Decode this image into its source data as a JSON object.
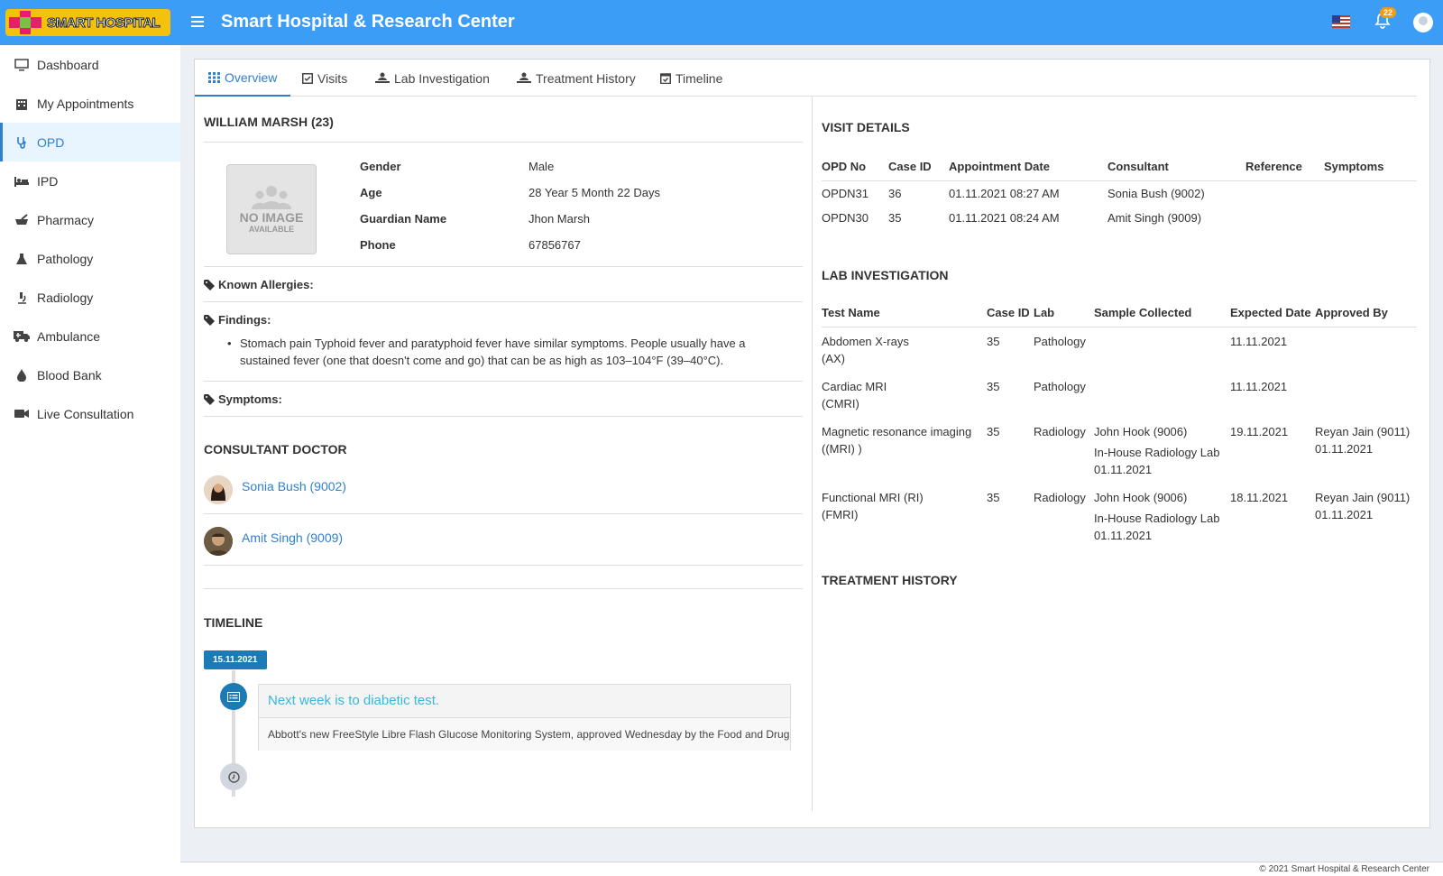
{
  "app": {
    "logo_text": "SMART HOSPITAL",
    "title": "Smart Hospital & Research Center",
    "notification_count": "22"
  },
  "sidebar": {
    "items": [
      {
        "label": "Dashboard",
        "icon": "monitor-icon"
      },
      {
        "label": "My Appointments",
        "icon": "building-icon"
      },
      {
        "label": "OPD",
        "icon": "stethoscope-icon"
      },
      {
        "label": "IPD",
        "icon": "bed-icon"
      },
      {
        "label": "Pharmacy",
        "icon": "mortar-pestle-icon"
      },
      {
        "label": "Pathology",
        "icon": "flask-icon"
      },
      {
        "label": "Radiology",
        "icon": "microscope-icon"
      },
      {
        "label": "Ambulance",
        "icon": "ambulance-icon"
      },
      {
        "label": "Blood Bank",
        "icon": "droplet-icon"
      },
      {
        "label": "Live Consultation",
        "icon": "video-icon"
      }
    ]
  },
  "tabs": [
    {
      "label": "Overview"
    },
    {
      "label": "Visits"
    },
    {
      "label": "Lab Investigation"
    },
    {
      "label": "Treatment History"
    },
    {
      "label": "Timeline"
    }
  ],
  "patient": {
    "name": "WILLIAM MARSH (23)",
    "no_image_big": "NO IMAGE",
    "no_image_small": "AVAILABLE",
    "fields": [
      {
        "label": "Gender",
        "value": "Male"
      },
      {
        "label": "Age",
        "value": "28 Year 5 Month 22 Days"
      },
      {
        "label": "Guardian Name",
        "value": "Jhon Marsh"
      },
      {
        "label": "Phone",
        "value": "67856767"
      }
    ],
    "known_allergies_label": "Known Allergies:",
    "findings_label": "Findings:",
    "findings_text": "Stomach pain Typhoid fever and paratyphoid fever have similar symptoms. People usually have a sustained fever (one that doesn't come and go) that can be as high as 103–104°F (39–40°C).",
    "symptoms_label": "Symptoms:"
  },
  "consultant": {
    "title": "CONSULTANT DOCTOR",
    "doctors": [
      {
        "name": "Sonia Bush (9002)"
      },
      {
        "name": "Amit Singh (9009)"
      }
    ]
  },
  "timeline": {
    "title": "TIMELINE",
    "date": "15.11.2021",
    "entry_title": "Next week is to diabetic test.",
    "entry_body": "Abbott's new FreeStyle Libre Flash Glucose Monitoring System, approved Wednesday by the Food and Drug"
  },
  "visit_details": {
    "title": "VISIT DETAILS",
    "headers": [
      "OPD No",
      "Case ID",
      "Appointment Date",
      "Consultant",
      "Reference",
      "Symptoms"
    ],
    "rows": [
      [
        "OPDN31",
        "36",
        "01.11.2021 08:27 AM",
        "Sonia Bush (9002)",
        "",
        ""
      ],
      [
        "OPDN30",
        "35",
        "01.11.2021 08:24 AM",
        "Amit Singh (9009)",
        "",
        ""
      ]
    ]
  },
  "lab_investigation": {
    "title": "LAB INVESTIGATION",
    "headers": [
      "Test Name",
      "Case ID",
      "Lab",
      "Sample Collected",
      "Expected Date",
      "Approved By"
    ],
    "rows": [
      {
        "test": "Abdomen X-rays",
        "short": "(AX)",
        "case": "35",
        "lab": "Pathology",
        "collected_by": "",
        "collected_lab": "",
        "collected_date": "",
        "expected": "11.11.2021",
        "approved_by": "",
        "approved_date": ""
      },
      {
        "test": "Cardiac MRI",
        "short": "(CMRI)",
        "case": "35",
        "lab": "Pathology",
        "collected_by": "",
        "collected_lab": "",
        "collected_date": "",
        "expected": "11.11.2021",
        "approved_by": "",
        "approved_date": ""
      },
      {
        "test": "Magnetic resonance imaging",
        "short": "((MRI) )",
        "case": "35",
        "lab": "Radiology",
        "collected_by": "John Hook (9006)",
        "collected_lab": "In-House Radiology Lab",
        "collected_date": "01.11.2021",
        "expected": "19.11.2021",
        "approved_by": "Reyan Jain (9011)",
        "approved_date": "01.11.2021"
      },
      {
        "test": "Functional MRI (RI)",
        "short": "(FMRI)",
        "case": "35",
        "lab": "Radiology",
        "collected_by": "John Hook (9006)",
        "collected_lab": "In-House Radiology Lab",
        "collected_date": "01.11.2021",
        "expected": "18.11.2021",
        "approved_by": "Reyan Jain (9011)",
        "approved_date": "01.11.2021"
      }
    ]
  },
  "treatment_history": {
    "title": "TREATMENT HISTORY"
  },
  "footer": {
    "text": "© 2021 Smart Hospital & Research Center"
  }
}
